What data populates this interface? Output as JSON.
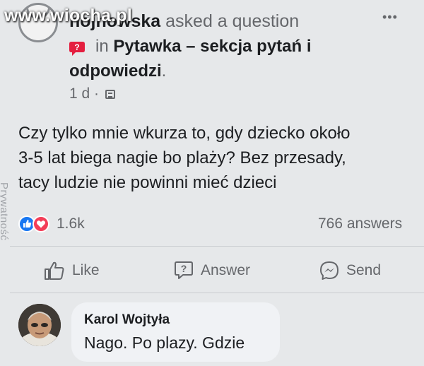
{
  "watermark": "www.wiocha.pl",
  "post": {
    "author": "Ola Chojnowska",
    "author_visible_part": "hojnowska",
    "action": "asked a question",
    "in_word": "in",
    "group_name": "Pytawka – sekcja pytań i",
    "group_name_cont": "odpowiedzi",
    "group_end": ".",
    "time": "1 d ·",
    "privacy_icon": "groups-icon",
    "more_label": "•••",
    "body_lines": [
      "Czy tylko mnie wkurza to, gdy  dziecko około",
      "3-5 lat biega nagie bo plaży? Bez przesady,",
      "tacy ludzie nie powinni mieć dzieci"
    ],
    "reaction_count": "1.6k",
    "answers_count": "766 answers",
    "side_label": "Prywatność"
  },
  "actions": {
    "like": "Like",
    "answer": "Answer",
    "send": "Send"
  },
  "comment": {
    "author": "Karol Wojtyła",
    "text": "Nago. Po plazy. Gdzie"
  },
  "colors": {
    "background": "#e6e8ea",
    "text": "#1c1e21",
    "muted": "#65676b",
    "like_blue": "#1877f2",
    "love_red": "#f33e58",
    "question_red": "#e41e3f"
  }
}
